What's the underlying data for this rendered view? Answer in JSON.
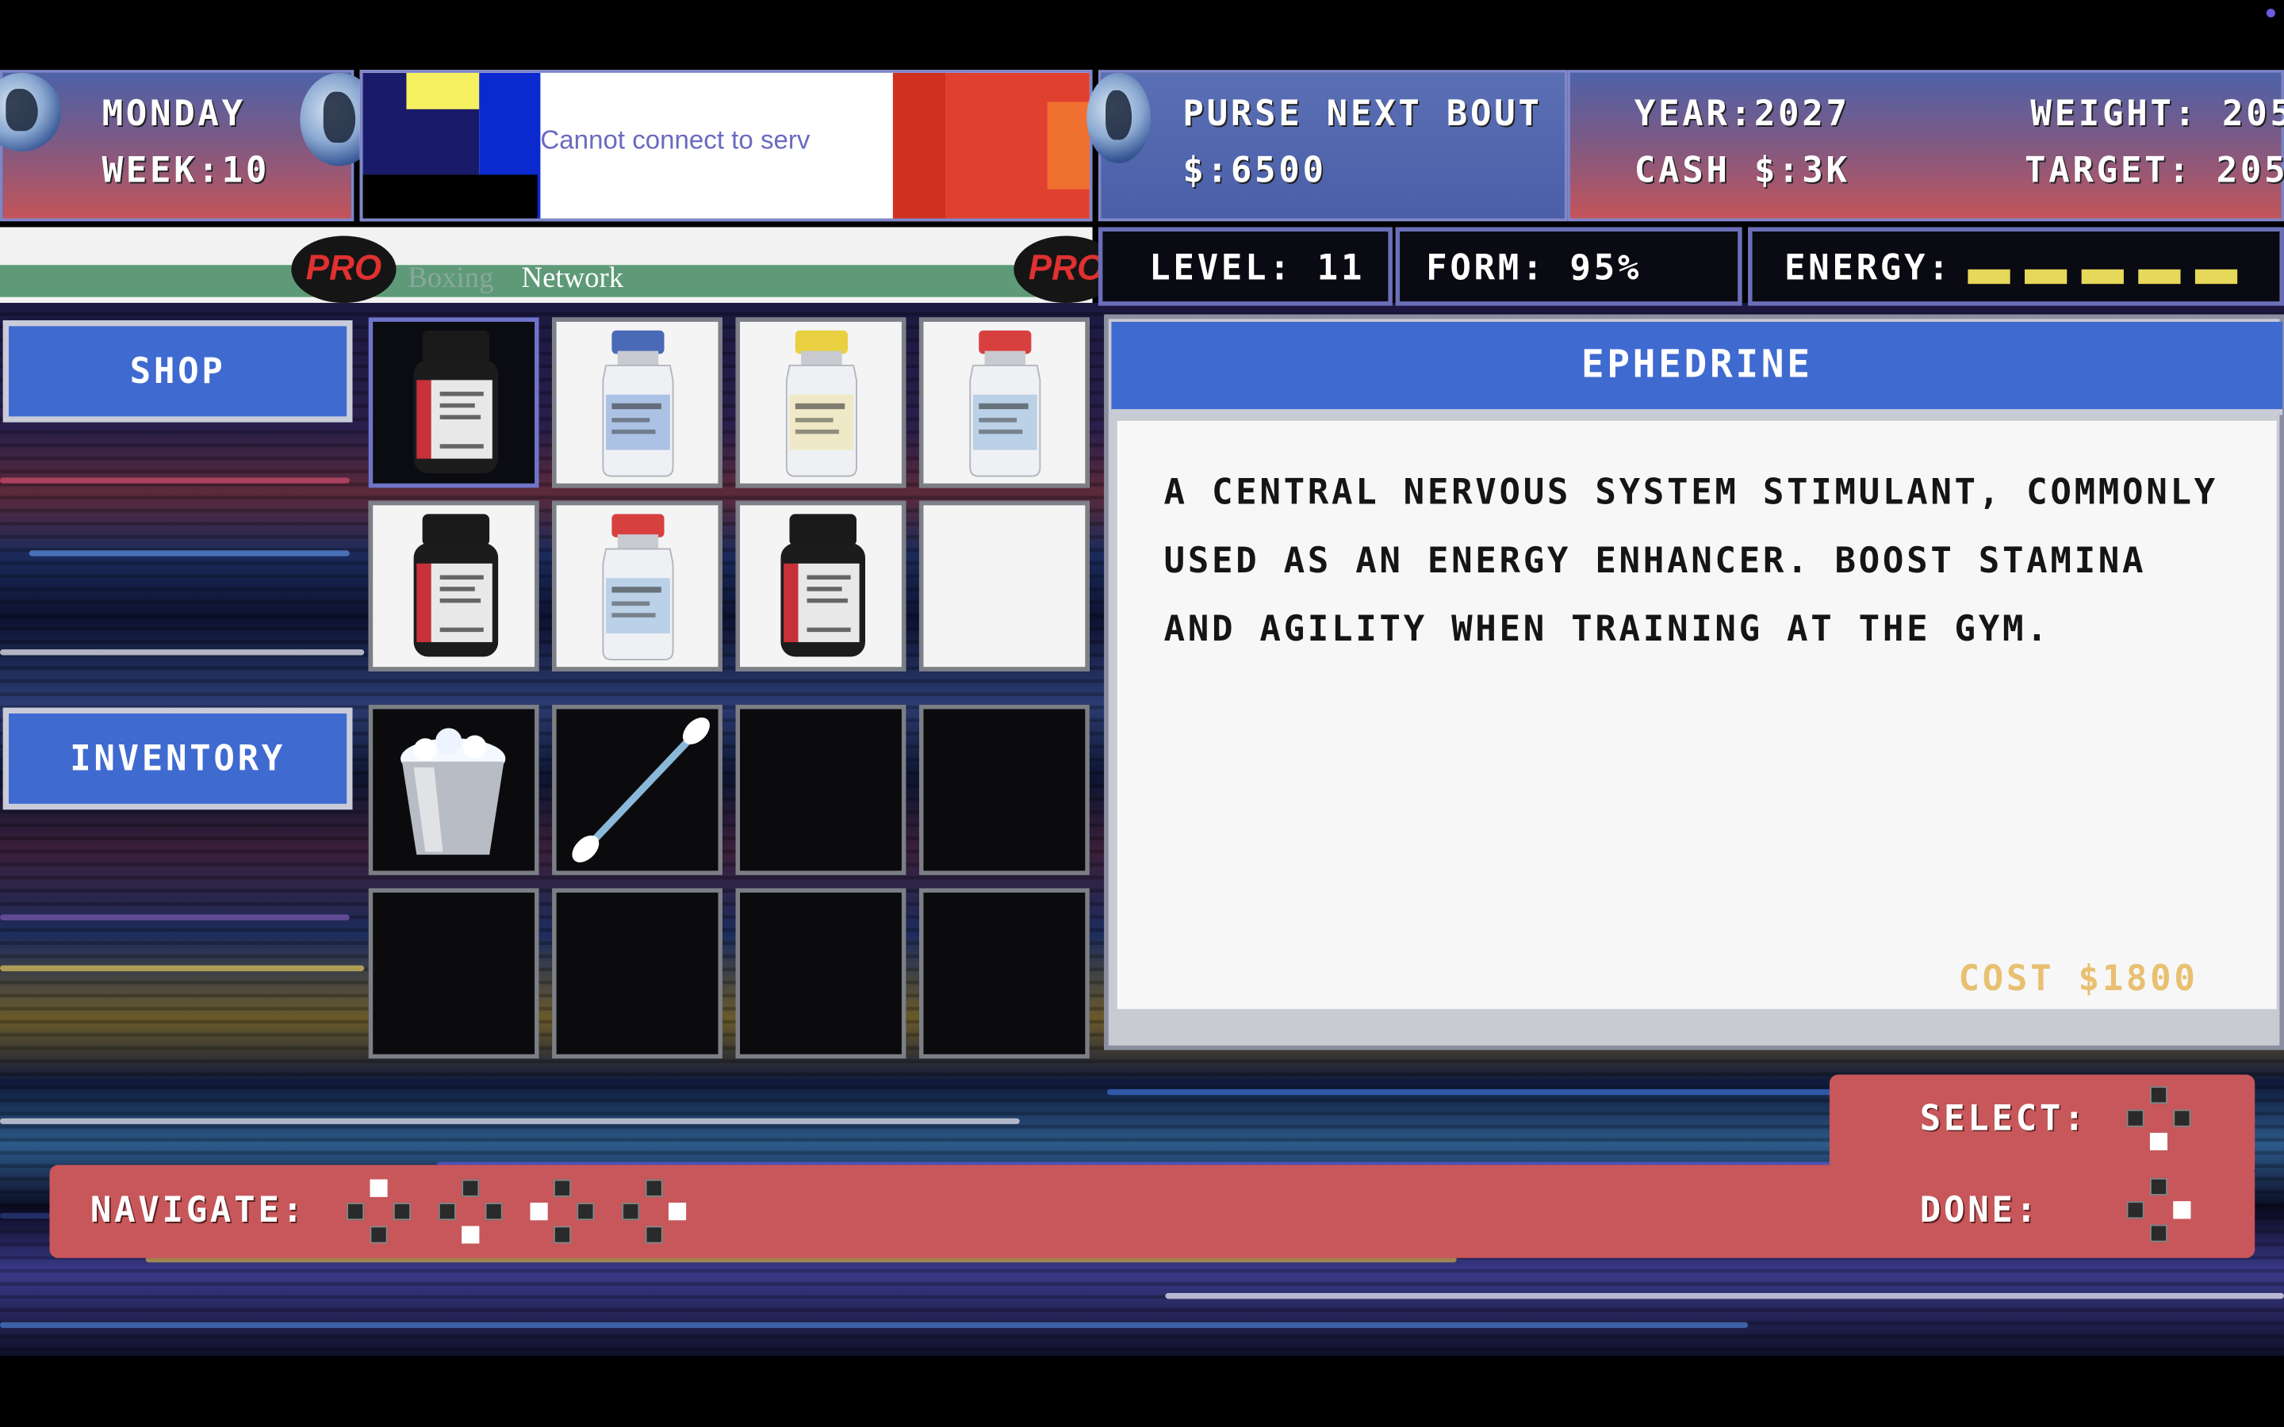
{
  "hud": {
    "day": "MONDAY",
    "week": "WEEK:10",
    "ad_text": "Cannot connect to serv",
    "network_pro": "PRO",
    "network_boxing": "Boxing",
    "network_name": "Network",
    "purse_label": "PURSE NEXT BOUT",
    "purse_value": "$:6500",
    "year": "YEAR:2027",
    "cash": "CASH  $:3K",
    "weight": "WEIGHT: 205",
    "target": "TARGET: 205"
  },
  "stats": {
    "level": "LEVEL: 11",
    "form": "FORM: 95%",
    "energy_label": "ENERGY:",
    "energy_bars": 5
  },
  "shop": {
    "label": "SHOP",
    "items": [
      {
        "icon": "pill-bottle-icon",
        "selected": true
      },
      {
        "icon": "vial-blue-cap-icon",
        "selected": false
      },
      {
        "icon": "vial-yellow-cap-icon",
        "selected": false
      },
      {
        "icon": "vial-red-cap-icon",
        "selected": false
      },
      {
        "icon": "pill-bottle-icon",
        "selected": false
      },
      {
        "icon": "vial-red-cap-icon",
        "selected": false
      },
      {
        "icon": "pill-bottle-icon",
        "selected": false
      },
      {
        "icon": "empty",
        "selected": false
      }
    ]
  },
  "inventory": {
    "label": "INVENTORY",
    "items": [
      {
        "icon": "ice-bucket-icon"
      },
      {
        "icon": "cotton-swab-icon"
      },
      {
        "icon": "empty"
      },
      {
        "icon": "empty"
      },
      {
        "icon": "empty"
      },
      {
        "icon": "empty"
      },
      {
        "icon": "empty"
      },
      {
        "icon": "empty"
      }
    ]
  },
  "detail": {
    "title": "EPHEDRINE",
    "description": "A CENTRAL NERVOUS SYSTEM STIMULANT, COMMONLY USED AS AN ENERGY ENHANCER. BOOST STAMINA AND AGILITY WHEN TRAINING AT THE GYM.",
    "cost": "COST $1800"
  },
  "controls": {
    "navigate_label": "NAVIGATE:",
    "select_label": "SELECT:",
    "done_label": "DONE:"
  },
  "colors": {
    "accent_blue": "#3f6ad0",
    "control_red": "#c7575a",
    "cost_gold": "#e8c070",
    "energy_yellow": "#e6d85a"
  }
}
